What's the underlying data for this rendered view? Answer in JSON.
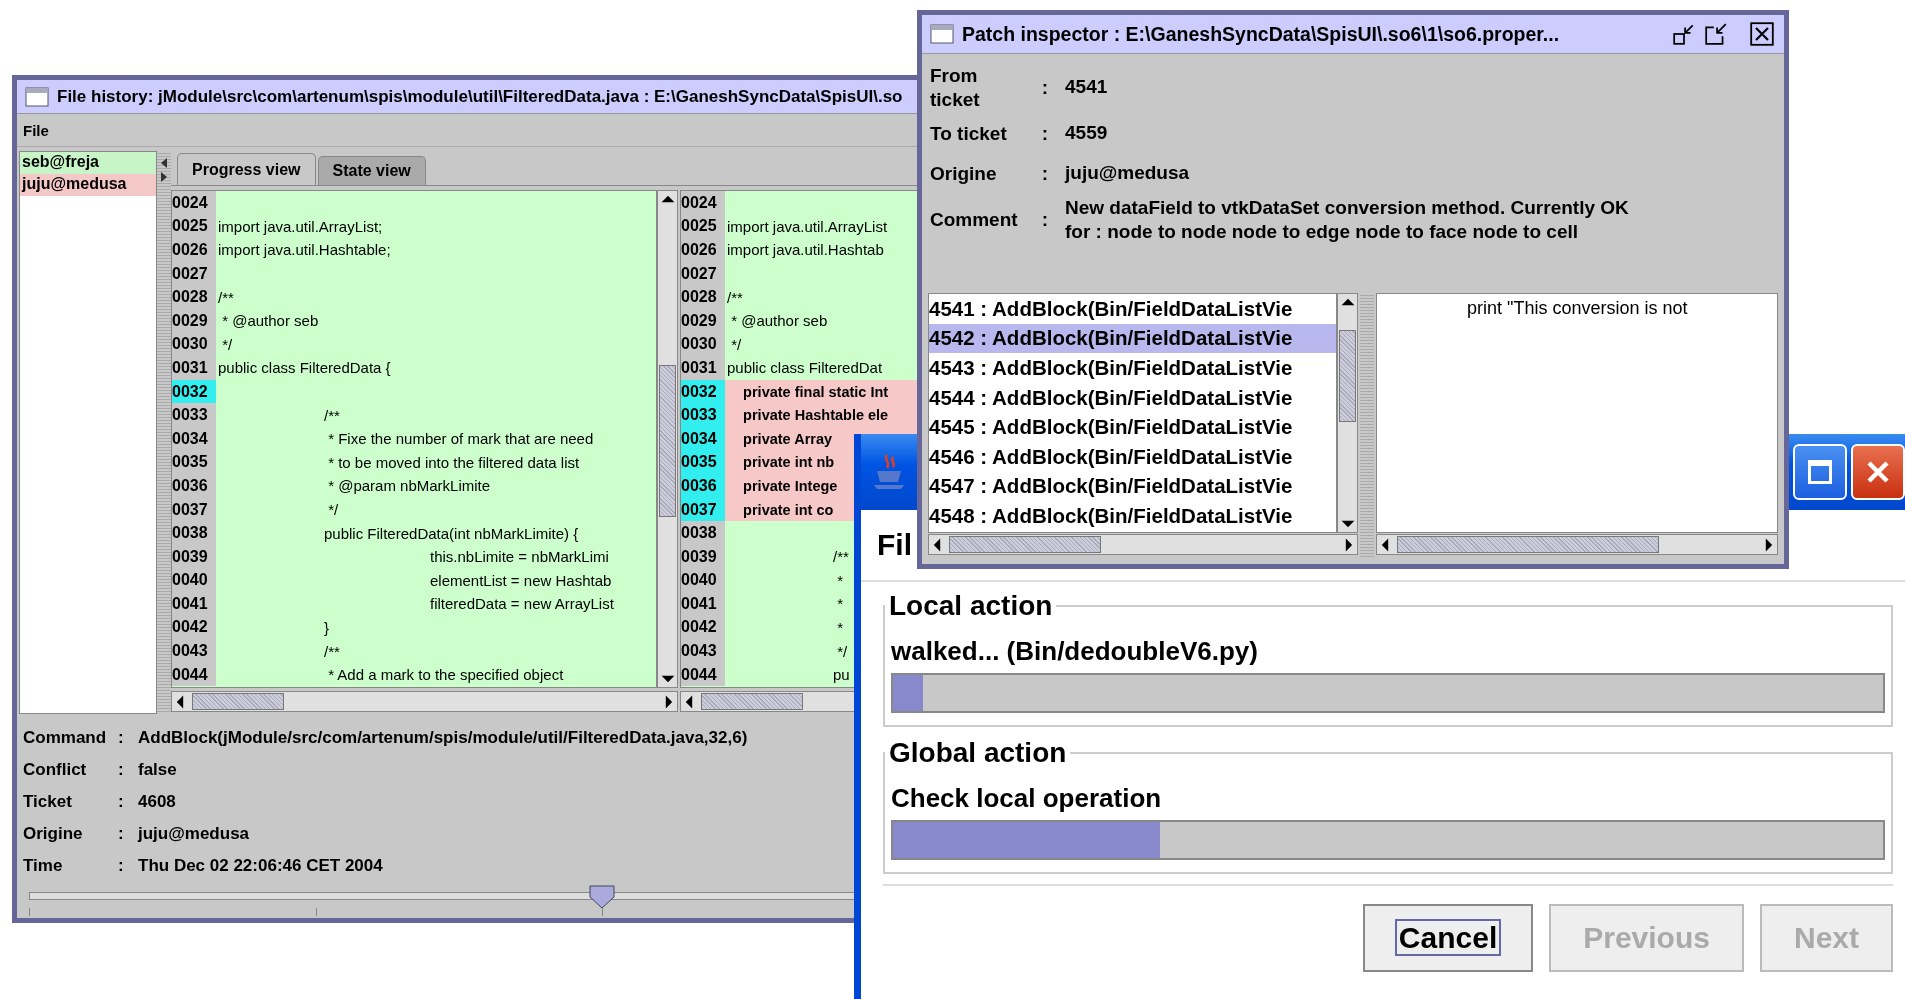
{
  "file_history": {
    "title": "File history: jModule\\src\\com\\artenum\\spis\\module\\util\\FilteredData.java : E:\\GaneshSyncData\\SpisUI\\.so",
    "menu": [
      "File"
    ],
    "authors": [
      {
        "name": "seb@freja",
        "color": "#c8f5c8"
      },
      {
        "name": "juju@medusa",
        "color": "#f5c8c8"
      }
    ],
    "tabs": [
      {
        "label": "Progress view",
        "selected": true
      },
      {
        "label": "State view",
        "selected": false
      }
    ],
    "left_pane": [
      {
        "number": "0024",
        "highlight": false,
        "inserted": false
      },
      {
        "number": "0025",
        "text": "import java.util.ArrayList;",
        "highlight": false,
        "inserted": false
      },
      {
        "number": "0026",
        "text": "import java.util.Hashtable;",
        "highlight": false,
        "inserted": false
      },
      {
        "number": "0027",
        "highlight": false,
        "inserted": false
      },
      {
        "number": "0028",
        "text": "/**",
        "highlight": false,
        "inserted": false
      },
      {
        "number": "0029",
        "text": " * @author seb",
        "highlight": false,
        "inserted": false
      },
      {
        "number": "0030",
        "text": " */",
        "highlight": false,
        "inserted": false
      },
      {
        "number": "0031",
        "text": "public class FilteredData {",
        "highlight": false,
        "inserted": false
      },
      {
        "number": "0032",
        "highlight": true,
        "inserted": false
      },
      {
        "number": "0033",
        "text": "\t/**",
        "highlight": false,
        "inserted": false
      },
      {
        "number": "0034",
        "text": "\t * Fixe the number of mark that are need",
        "highlight": false,
        "inserted": false
      },
      {
        "number": "0035",
        "text": "\t * to be moved into the filtered data list",
        "highlight": false,
        "inserted": false
      },
      {
        "number": "0036",
        "text": "\t * @param nbMarkLimite",
        "highlight": false,
        "inserted": false
      },
      {
        "number": "0037",
        "text": "\t */",
        "highlight": false,
        "inserted": false
      },
      {
        "number": "0038",
        "text": "\tpublic FilteredData(int nbMarkLimite) {",
        "highlight": false,
        "inserted": false
      },
      {
        "number": "0039",
        "text": "\t\tthis.nbLimite = nbMarkLimi",
        "highlight": false,
        "inserted": false
      },
      {
        "number": "0040",
        "text": "\t\telementList = new Hashtab",
        "highlight": false,
        "inserted": false
      },
      {
        "number": "0041",
        "text": "\t\tfilteredData = new ArrayList",
        "highlight": false,
        "inserted": false
      },
      {
        "number": "0042",
        "text": "\t}",
        "highlight": false,
        "inserted": false
      },
      {
        "number": "0043",
        "text": "\t/**",
        "highlight": false,
        "inserted": false
      },
      {
        "number": "0044",
        "text": "\t * Add a mark to the specified object",
        "highlight": false,
        "inserted": false
      }
    ],
    "right_pane": [
      {
        "number": "0024",
        "highlight": false,
        "inserted": false
      },
      {
        "number": "0025",
        "text": "import java.util.ArrayList",
        "highlight": false,
        "inserted": false
      },
      {
        "number": "0026",
        "text": "import java.util.Hashtab",
        "highlight": false,
        "inserted": false
      },
      {
        "number": "0027",
        "highlight": false,
        "inserted": false
      },
      {
        "number": "0028",
        "text": "/**",
        "highlight": false,
        "inserted": false
      },
      {
        "number": "0029",
        "text": " * @author seb",
        "highlight": false,
        "inserted": false
      },
      {
        "number": "0030",
        "text": " */",
        "highlight": false,
        "inserted": false
      },
      {
        "number": "0031",
        "text": "public class FilteredDat",
        "highlight": false,
        "inserted": false
      },
      {
        "number": "0032",
        "text": "    private final static Int",
        "highlight": true,
        "inserted": true
      },
      {
        "number": "0033",
        "text": "    private Hashtable ele",
        "highlight": true,
        "inserted": true
      },
      {
        "number": "0034",
        "text": "    private Array",
        "highlight": true,
        "inserted": true
      },
      {
        "number": "0035",
        "text": "    private int nb",
        "highlight": true,
        "inserted": true
      },
      {
        "number": "0036",
        "text": "    private Intege",
        "highlight": true,
        "inserted": true
      },
      {
        "number": "0037",
        "text": "    private int co",
        "highlight": true,
        "inserted": true
      },
      {
        "number": "0038",
        "highlight": false,
        "inserted": false
      },
      {
        "number": "0039",
        "text": "\t/**",
        "highlight": false,
        "inserted": false
      },
      {
        "number": "0040",
        "text": "\t *",
        "highlight": false,
        "inserted": false
      },
      {
        "number": "0041",
        "text": "\t *",
        "highlight": false,
        "inserted": false
      },
      {
        "number": "0042",
        "text": "\t *",
        "highlight": false,
        "inserted": false
      },
      {
        "number": "0043",
        "text": "\t */",
        "highlight": false,
        "inserted": false
      },
      {
        "number": "0044",
        "text": "\tpu",
        "highlight": false,
        "inserted": false
      }
    ],
    "details": [
      {
        "label": "Command",
        "sep": ":",
        "value": "AddBlock(jModule/src/com/artenum/spis/module/util/FilteredData.java,32,6)"
      },
      {
        "label": "Conflict",
        "sep": ":",
        "value": "false"
      },
      {
        "label": "Ticket",
        "sep": ":",
        "value": "4608"
      },
      {
        "label": "Origine",
        "sep": ":",
        "value": "juju@medusa"
      },
      {
        "label": "Time",
        "sep": ":",
        "value": "Thu Dec 02 22:06:46 CET 2004"
      }
    ],
    "slider": {
      "level": 0.5
    }
  },
  "patch_inspector": {
    "title": "Patch inspector : E:\\GaneshSyncData\\SpisUI\\.so6\\1\\so6.proper...",
    "fields": [
      {
        "label": "From ticket",
        "sep": ":",
        "value": "4541"
      },
      {
        "label": "To ticket",
        "sep": ":",
        "value": "4559"
      },
      {
        "label": "Origine",
        "sep": ":",
        "value": "juju@medusa"
      },
      {
        "label": "Comment",
        "sep": ":",
        "value": "New dataField to vtkDataSet conversion method. Currently OK for : node to node node to edge node to face node to cell"
      }
    ],
    "patches": [
      {
        "label": "4541 : AddBlock(Bin/FieldDataListVie",
        "selected": false
      },
      {
        "label": "4542 : AddBlock(Bin/FieldDataListVie",
        "selected": true
      },
      {
        "label": "4543 : AddBlock(Bin/FieldDataListVie",
        "selected": false
      },
      {
        "label": "4544 : AddBlock(Bin/FieldDataListVie",
        "selected": false
      },
      {
        "label": "4545 : AddBlock(Bin/FieldDataListVie",
        "selected": false
      },
      {
        "label": "4546 : AddBlock(Bin/FieldDataListVie",
        "selected": false
      },
      {
        "label": "4547 : AddBlock(Bin/FieldDataListVie",
        "selected": false
      },
      {
        "label": "4548 : AddBlock(Bin/FieldDataListVie",
        "selected": false
      }
    ],
    "preview": "print \"This conversion is not"
  },
  "dialog": {
    "heading": "Fil",
    "groups": [
      {
        "title": "Local action",
        "status": "walked... (Bin/dedoubleV6.py)",
        "level": 0.03
      },
      {
        "title": "Global action",
        "status": "Check local operation",
        "level": 0.27
      }
    ],
    "buttons": [
      {
        "label": "Cancel",
        "disabled": false,
        "focused": true
      },
      {
        "label": "Previous",
        "disabled": true,
        "focused": false
      },
      {
        "label": "Next",
        "disabled": true,
        "focused": false
      }
    ]
  }
}
